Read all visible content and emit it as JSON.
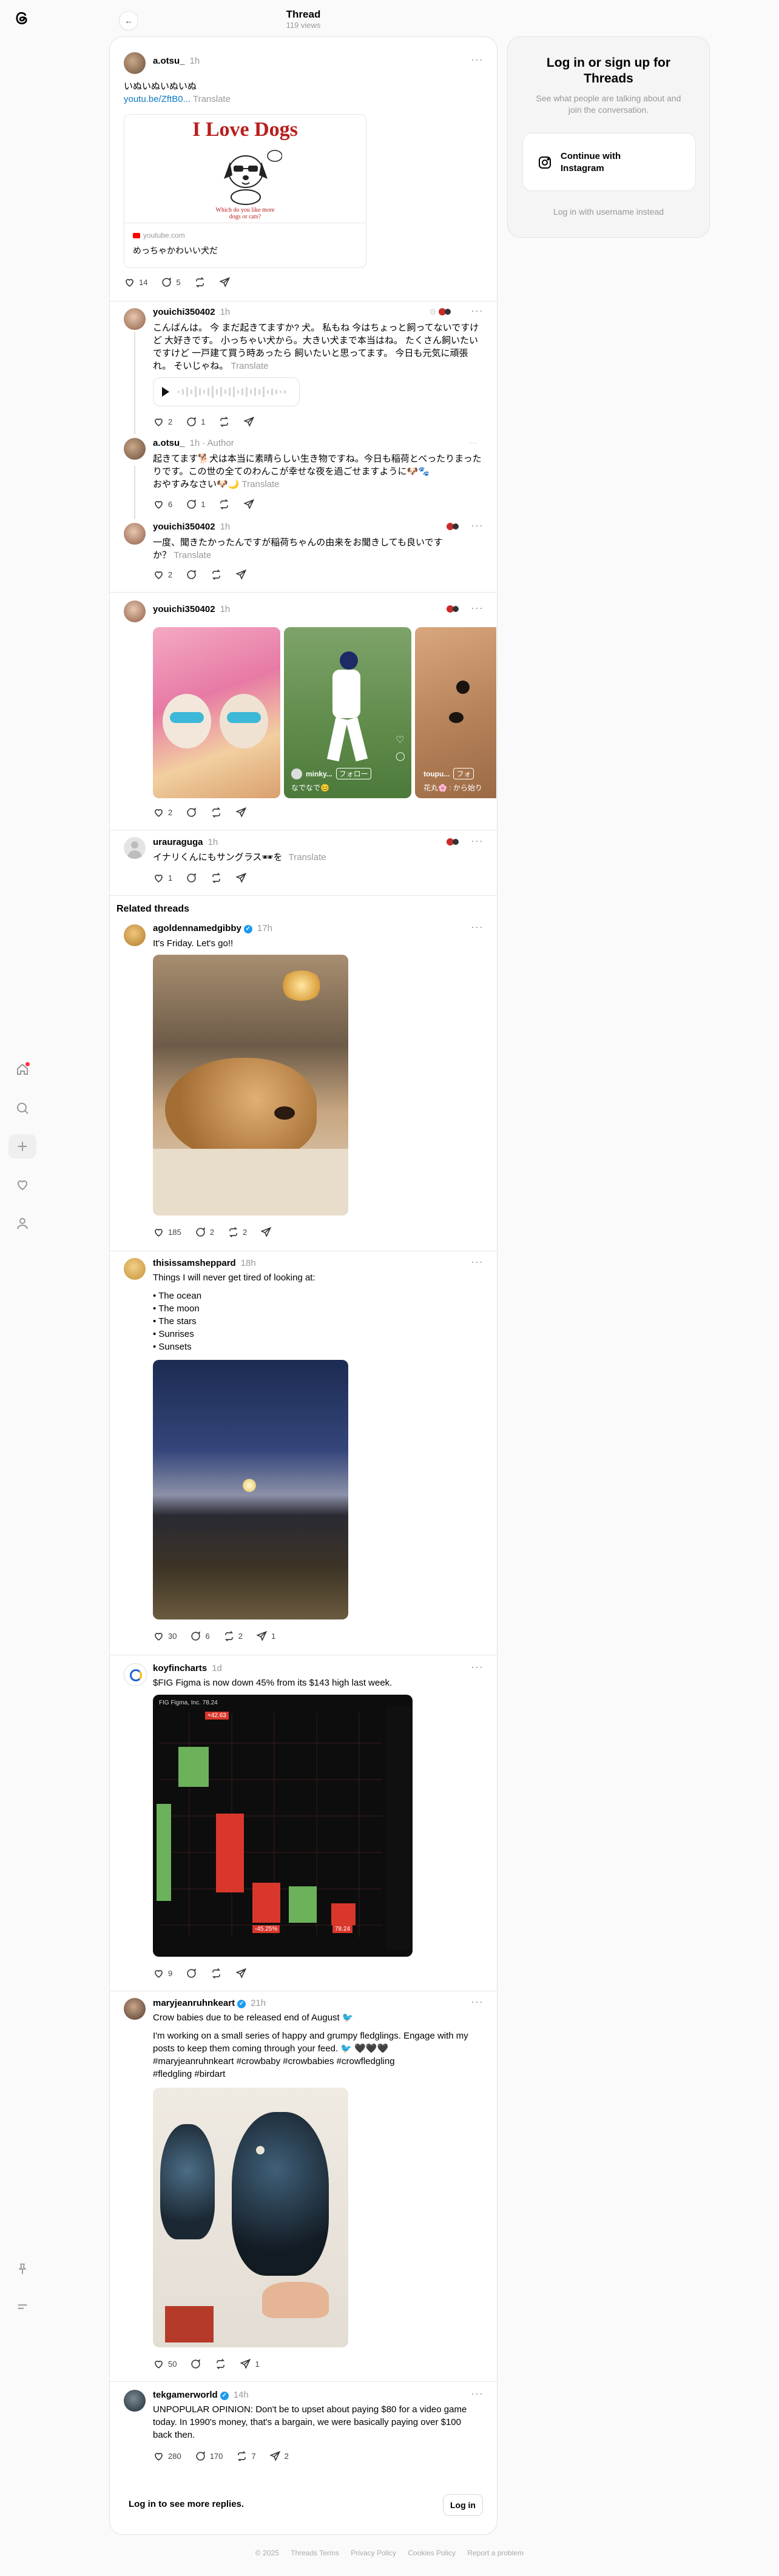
{
  "header": {
    "title": "Thread",
    "views": "119 views"
  },
  "rail": {
    "icons": [
      "threads-logo",
      "home-icon",
      "search-icon",
      "plus-icon",
      "heart-icon",
      "user-icon",
      "pin-icon",
      "menu-icon"
    ]
  },
  "colors": {
    "link": "#0a7bc2",
    "verified": "#1d9bf0",
    "muted": "#999999"
  },
  "main_post": {
    "user": "a.otsu_",
    "time": "1h",
    "line1": "いぬいぬいぬいぬ",
    "link": "youtu.be/ZftB0...",
    "translate": "Translate",
    "card_title": "I Love Dogs",
    "card_sub": "Which do you like more\ndogs or cats?",
    "card_source": "youtube.com",
    "card_caption": "めっちゃかわいい犬だ",
    "likes": "14",
    "replies": "5"
  },
  "replies": [
    {
      "user": "youichi350402",
      "time": "1h",
      "text": "こんばんは。 今 まだ起きてますか? 犬。 私もね 今はちょっと飼ってないですけど 大好きです。 小っちゃい犬から。大きい犬まで本当はね。 たくさん飼いたいですけど 一戸建て買う時あったら 飼いたいと思ってます。 今日も元気に頑張れ。 そいじゃね。",
      "translate": "Translate",
      "likes": "2",
      "replies": "1"
    },
    {
      "user": "a.otsu_",
      "time": "1h",
      "author": "· Author",
      "text": "起きてます🐕犬は本当に素晴らしい生き物ですね。今日も稲荷とべったりまったりです。この世の全てのわんこが幸せな夜を過ごせますように🐶🐾\nおやすみなさい🐶🌙",
      "translate": "Translate",
      "likes": "6",
      "replies": "1"
    },
    {
      "user": "youichi350402",
      "time": "1h",
      "text": "一度、聞きたかったんですが稲荷ちゃんの由来をお聞きしても良いですか？",
      "translate": "Translate",
      "likes": "2"
    }
  ],
  "media_post": {
    "user": "youichi350402",
    "time": "1h",
    "likes": "2",
    "tile2_user": "minky...",
    "tile2_follow": "フォロー",
    "tile2_caption": "なでなで😊",
    "tile3_user": "toupu...",
    "tile3_follow": "フォ",
    "tile3_caption": "花丸🌸 : から始り"
  },
  "small_post": {
    "user": "urauraguga",
    "time": "1h",
    "text": "イナリくんにもサングラス🕶を",
    "translate": "Translate",
    "likes": "1"
  },
  "related": {
    "heading": "Related threads",
    "posts": [
      {
        "user": "agoldennamedgibby",
        "verified": true,
        "time": "17h",
        "text": "It's Friday. Let's go!!",
        "likes": "185",
        "replies": "2",
        "reposts": "2"
      },
      {
        "user": "thisissamsheppard",
        "time": "18h",
        "text": "Things I will never get tired of looking at:",
        "list": [
          "• The ocean",
          "• The moon",
          "• The stars",
          "• Sunrises",
          "• Sunsets"
        ],
        "likes": "30",
        "replies": "6",
        "reposts": "2",
        "shares": "1"
      },
      {
        "user": "koyfincharts",
        "time": "1d",
        "text": "$FIG Figma is now down 45% from its $143 high last week.",
        "likes": "9",
        "chart_header": "FIG Figma, Inc. 78.24",
        "chart_labels": [
          "+42.63",
          "-45.25%",
          "78.24"
        ]
      },
      {
        "user": "maryjeanruhnkeart",
        "verified": true,
        "time": "21h",
        "text": "Crow babies due to be released end of August 🐦",
        "text2": "I'm working on a small series of happy and grumpy fledglings. Engage with my posts to keep them coming through your feed. 🐦 🖤🖤🖤",
        "text3": "#maryjeanruhnkeart #crowbaby #crowbabies #crowfledgling",
        "text4": "#fledgling #birdart",
        "likes": "50",
        "shares": "1"
      },
      {
        "user": "tekgamerworld",
        "verified": true,
        "time": "14h",
        "text": "UNPOPULAR OPINION: Don't be to upset about paying $80 for a video game today. In 1990's money, that's a bargain, we were basically paying over $100 back then.",
        "likes": "280",
        "replies": "170",
        "reposts": "7",
        "shares": "2"
      }
    ]
  },
  "see_more": {
    "text": "Log in to see more replies.",
    "button": "Log in"
  },
  "login_card": {
    "title": "Log in or sign up for Threads",
    "subtitle": "See what people are talking about and join the conversation.",
    "button": "Continue with Instagram",
    "alt": "Log in with username instead"
  },
  "footer": [
    "© 2025",
    "Threads Terms",
    "Privacy Policy",
    "Cookies Policy",
    "Report a problem"
  ]
}
